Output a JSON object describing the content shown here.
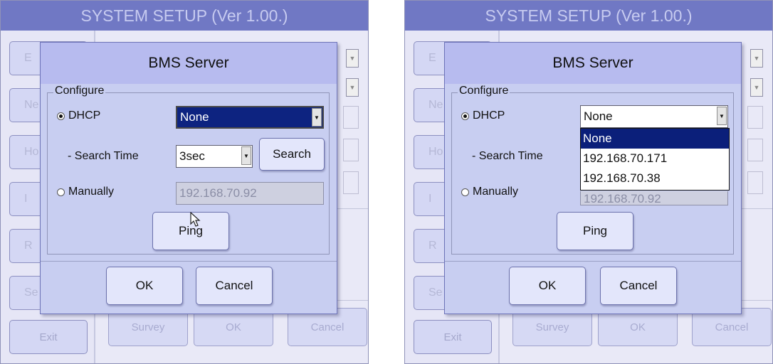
{
  "window_title": "SYSTEM SETUP (Ver 1.00.)",
  "background": {
    "side_letters": [
      "E",
      "Ne",
      "Ho",
      "I",
      "R",
      "Se"
    ],
    "exit_label": "Exit",
    "bottom_buttons": [
      "Survey",
      "OK",
      "Cancel"
    ]
  },
  "dialog": {
    "title": "BMS Server",
    "group_label": "Configure",
    "dhcp_label": "DHCP",
    "dhcp_selected": "None",
    "search_time_label": "- Search Time",
    "search_time_value": "3sec",
    "search_button": "Search",
    "manually_label": "Manually",
    "manual_ip": "192.168.70.92",
    "ping_button": "Ping",
    "ok_button": "OK",
    "cancel_button": "Cancel",
    "dropdown_options": [
      "None",
      "192.168.70.171",
      "192.168.70.38"
    ]
  },
  "colors": {
    "title_bar": "#7078c4",
    "dialog_bg": "#c8cef1",
    "selection": "#0d2380"
  }
}
